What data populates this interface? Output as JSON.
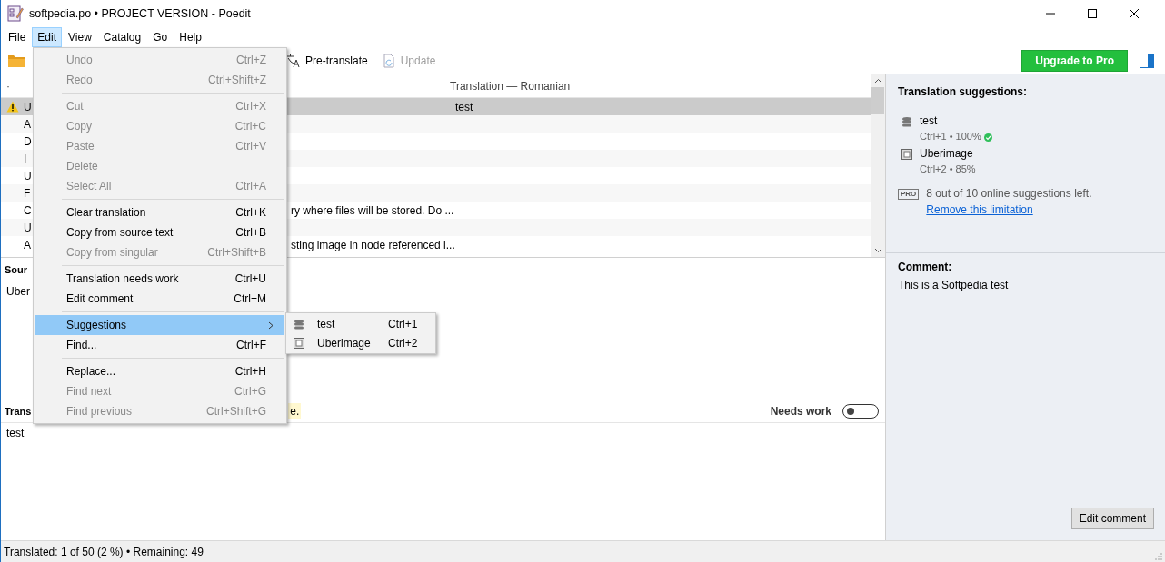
{
  "window": {
    "title": "softpedia.po • PROJECT VERSION - Poedit"
  },
  "menu_bar": [
    {
      "label": "File",
      "selected": false
    },
    {
      "label": "Edit",
      "selected": true
    },
    {
      "label": "View",
      "selected": false
    },
    {
      "label": "Catalog",
      "selected": false
    },
    {
      "label": "Go",
      "selected": false
    },
    {
      "label": "Help",
      "selected": false
    }
  ],
  "toolbar": {
    "items": [
      {
        "kind": "open"
      },
      {
        "kind": "pretranslate",
        "label": "Pre-translate",
        "disabled": false
      },
      {
        "kind": "update",
        "label": "Update",
        "disabled": true
      }
    ],
    "upgrade_button": "Upgrade to Pro"
  },
  "list": {
    "columns": [
      "·",
      "Translation — Romanian"
    ],
    "rows": [
      {
        "source_start": "U",
        "source_end": "",
        "translation": "test",
        "selected": true,
        "warning": true
      },
      {
        "source_start": "A",
        "source_end": "",
        "translation": "",
        "selected": false,
        "warning": false
      },
      {
        "source_start": "D",
        "source_end": "",
        "translation": "",
        "selected": false,
        "warning": false
      },
      {
        "source_start": "I",
        "source_end": "",
        "translation": "",
        "selected": false,
        "warning": false
      },
      {
        "source_start": "U",
        "source_end": "",
        "translation": "",
        "selected": false,
        "warning": false
      },
      {
        "source_start": "F",
        "source_end": "",
        "translation": "",
        "selected": false,
        "warning": false
      },
      {
        "source_start": "C",
        "source_end": "ry where files will be stored. Do ...",
        "translation": "",
        "selected": false,
        "warning": false
      },
      {
        "source_start": "U",
        "source_end": "",
        "translation": "",
        "selected": false,
        "warning": false
      },
      {
        "source_start": "A",
        "source_end": "sting image in node referenced i...",
        "translation": "",
        "selected": false,
        "warning": false
      }
    ]
  },
  "source_pane": {
    "heading": "Sour",
    "text": "Uber"
  },
  "translation_pane": {
    "heading": "Trans",
    "hint": "e.",
    "needs_work_label": "Needs work",
    "needs_work": false,
    "text": "test"
  },
  "edit_menu": [
    {
      "kind": "item",
      "label": "Undo",
      "shortcut": "Ctrl+Z",
      "disabled": true,
      "selected": false
    },
    {
      "kind": "item",
      "label": "Redo",
      "shortcut": "Ctrl+Shift+Z",
      "disabled": true,
      "selected": false
    },
    {
      "kind": "separator"
    },
    {
      "kind": "item",
      "label": "Cut",
      "shortcut": "Ctrl+X",
      "disabled": true,
      "selected": false
    },
    {
      "kind": "item",
      "label": "Copy",
      "shortcut": "Ctrl+C",
      "disabled": true,
      "selected": false
    },
    {
      "kind": "item",
      "label": "Paste",
      "shortcut": "Ctrl+V",
      "disabled": true,
      "selected": false
    },
    {
      "kind": "item",
      "label": "Delete",
      "disabled": true,
      "selected": false
    },
    {
      "kind": "item",
      "label": "Select All",
      "shortcut": "Ctrl+A",
      "disabled": true,
      "selected": false
    },
    {
      "kind": "separator"
    },
    {
      "kind": "item",
      "label": "Clear translation",
      "shortcut": "Ctrl+K",
      "disabled": false,
      "selected": false
    },
    {
      "kind": "item",
      "label": "Copy from source text",
      "shortcut": "Ctrl+B",
      "disabled": false,
      "selected": false
    },
    {
      "kind": "item",
      "label": "Copy from singular",
      "shortcut": "Ctrl+Shift+B",
      "disabled": true,
      "selected": false
    },
    {
      "kind": "separator"
    },
    {
      "kind": "item",
      "label": "Translation needs work",
      "shortcut": "Ctrl+U",
      "disabled": false,
      "selected": false
    },
    {
      "kind": "item",
      "label": "Edit comment",
      "shortcut": "Ctrl+M",
      "disabled": false,
      "selected": false
    },
    {
      "kind": "separator"
    },
    {
      "kind": "submenu",
      "label": "Suggestions",
      "disabled": false,
      "selected": true
    },
    {
      "kind": "item",
      "label": "Find...",
      "shortcut": "Ctrl+F",
      "disabled": false,
      "selected": false
    },
    {
      "kind": "separator"
    },
    {
      "kind": "item",
      "label": "Replace...",
      "shortcut": "Ctrl+H",
      "disabled": false,
      "selected": false
    },
    {
      "kind": "item",
      "label": "Find next",
      "shortcut": "Ctrl+G",
      "disabled": true,
      "selected": false
    },
    {
      "kind": "item",
      "label": "Find previous",
      "shortcut": "Ctrl+Shift+G",
      "disabled": true,
      "selected": false
    }
  ],
  "suggestions_submenu": [
    {
      "kind": "memory",
      "label": "test",
      "shortcut": "Ctrl+1"
    },
    {
      "kind": "machine",
      "label": "Uberimage",
      "shortcut": "Ctrl+2"
    }
  ],
  "sidebar": {
    "heading": "Translation suggestions:",
    "suggestions": [
      {
        "kind": "memory",
        "text": "test",
        "meta": "Ctrl+1 • 100%",
        "exact": true
      },
      {
        "kind": "machine",
        "text": "Uberimage",
        "meta": "Ctrl+2 • 85%",
        "exact": false
      }
    ],
    "pro_badge": "PRO",
    "pro_note": "8 out of 10 online suggestions left.",
    "pro_link": "Remove this limitation",
    "comment_heading": "Comment:",
    "comment": "This is a Softpedia test",
    "edit_comment_button": "Edit comment"
  },
  "status_bar": "Translated: 1 of 50 (2 %)  •  Remaining: 49"
}
